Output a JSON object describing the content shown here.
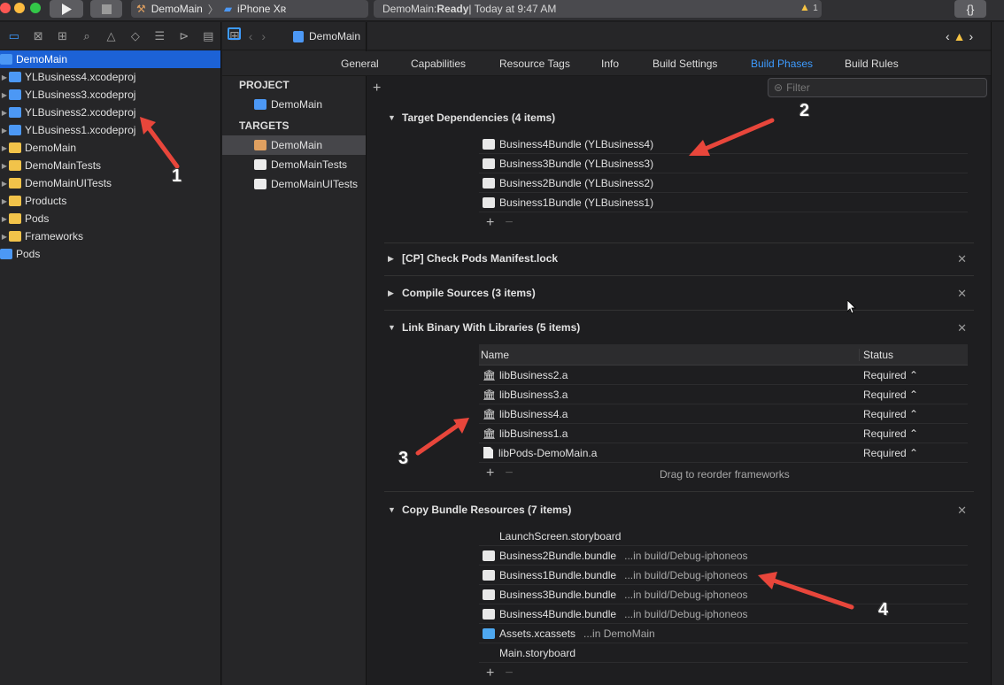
{
  "toolbar": {
    "scheme_target": "DemoMain",
    "scheme_device": "iPhone Xʀ",
    "status_app": "DemoMain: ",
    "status_state": "Ready",
    "status_time": " | Today at 9:47 AM",
    "warning_count": "1",
    "braces": "{}"
  },
  "navigator": {
    "items": [
      {
        "label": "DemoMain",
        "type": "proj",
        "selected": true
      },
      {
        "label": "YLBusiness4.xcodeproj",
        "type": "proj"
      },
      {
        "label": "YLBusiness3.xcodeproj",
        "type": "proj"
      },
      {
        "label": "YLBusiness2.xcodeproj",
        "type": "proj"
      },
      {
        "label": "YLBusiness1.xcodeproj",
        "type": "proj"
      },
      {
        "label": "DemoMain",
        "type": "folder"
      },
      {
        "label": "DemoMainTests",
        "type": "folder"
      },
      {
        "label": "DemoMainUITests",
        "type": "folder"
      },
      {
        "label": "Products",
        "type": "folder"
      },
      {
        "label": "Pods",
        "type": "folder"
      },
      {
        "label": "Frameworks",
        "type": "folder"
      },
      {
        "label": "Pods",
        "type": "proj"
      }
    ]
  },
  "breadcrumb": "DemoMain",
  "tabs": [
    "General",
    "Capabilities",
    "Resource Tags",
    "Info",
    "Build Settings",
    "Build Phases",
    "Build Rules"
  ],
  "active_tab": "Build Phases",
  "targets_panel": {
    "project_label": "PROJECT",
    "project_item": "DemoMain",
    "targets_label": "TARGETS",
    "targets": [
      "DemoMain",
      "DemoMainTests",
      "DemoMainUITests"
    ]
  },
  "filter_placeholder": "Filter",
  "phases": {
    "deps": {
      "title": "Target Dependencies (4 items)",
      "items": [
        "Business4Bundle (YLBusiness4)",
        "Business3Bundle (YLBusiness3)",
        "Business2Bundle (YLBusiness2)",
        "Business1Bundle (YLBusiness1)"
      ]
    },
    "check_pods": {
      "title": "[CP] Check Pods Manifest.lock"
    },
    "compile": {
      "title": "Compile Sources (3 items)"
    },
    "link": {
      "title": "Link Binary With Libraries (5 items)",
      "col_name": "Name",
      "col_status": "Status",
      "rows": [
        {
          "name": "libBusiness2.a",
          "status": "Required ⌃"
        },
        {
          "name": "libBusiness3.a",
          "status": "Required ⌃"
        },
        {
          "name": "libBusiness4.a",
          "status": "Required ⌃"
        },
        {
          "name": "libBusiness1.a",
          "status": "Required ⌃"
        },
        {
          "name": "libPods-DemoMain.a",
          "status": "Required ⌃"
        }
      ],
      "hint": "Drag to reorder frameworks"
    },
    "copy": {
      "title": "Copy Bundle Resources (7 items)",
      "items": [
        {
          "name": "LaunchScreen.storyboard",
          "loc": ""
        },
        {
          "name": "Business2Bundle.bundle",
          "loc": "...in build/Debug-iphoneos"
        },
        {
          "name": "Business1Bundle.bundle",
          "loc": "...in build/Debug-iphoneos"
        },
        {
          "name": "Business3Bundle.bundle",
          "loc": "...in build/Debug-iphoneos"
        },
        {
          "name": "Business4Bundle.bundle",
          "loc": "...in build/Debug-iphoneos"
        },
        {
          "name": "Assets.xcassets",
          "loc": "...in DemoMain"
        },
        {
          "name": "Main.storyboard",
          "loc": ""
        }
      ]
    }
  },
  "annotations": [
    "1",
    "2",
    "3",
    "4"
  ],
  "colors": {
    "accent": "#3d9bff",
    "selection": "#1c62d6",
    "arrow": "#e8463b"
  }
}
